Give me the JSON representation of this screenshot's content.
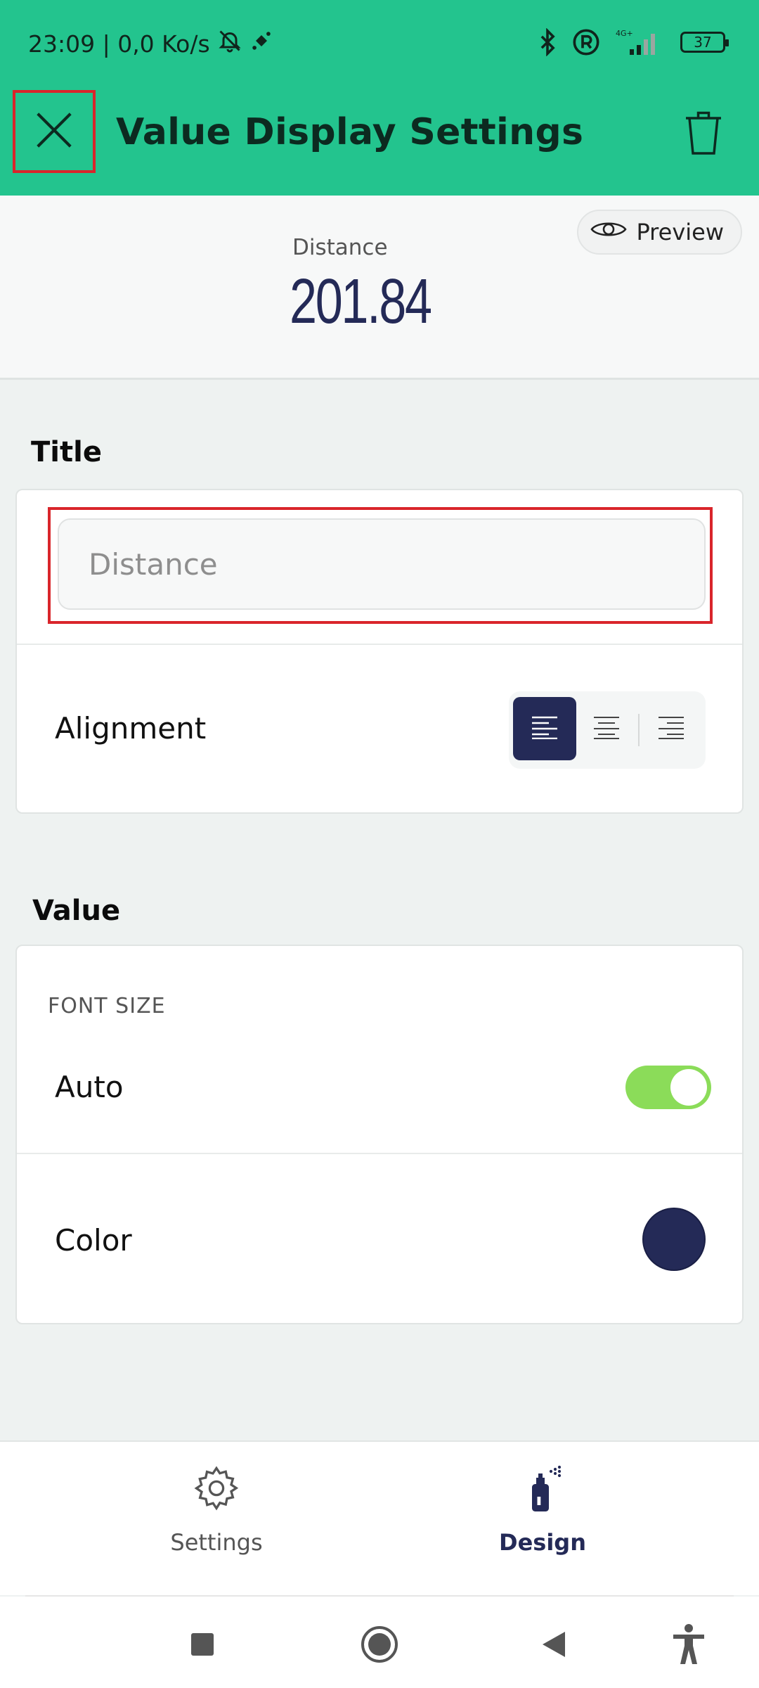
{
  "status_bar": {
    "time_info": "23:09 | 0,0 Ko/s",
    "network_label": "4G+",
    "battery": "37"
  },
  "app_bar": {
    "title": "Value Display Settings",
    "close_icon": "close-icon",
    "delete_icon": "trash-icon"
  },
  "preview": {
    "title": "Distance",
    "value": "201.84",
    "button_label": "Preview",
    "button_icon": "eye-icon"
  },
  "title_section": {
    "header": "Title",
    "input_placeholder": "Distance",
    "alignment_label": "Alignment",
    "alignment_options": [
      "left",
      "center",
      "right"
    ],
    "alignment_selected": "left"
  },
  "value_section": {
    "header": "Value",
    "font_size_caption": "FONT SIZE",
    "auto_label": "Auto",
    "auto_enabled": true,
    "color_label": "Color",
    "color_value": "#242a57"
  },
  "bottom_nav": {
    "items": [
      {
        "label": "Settings",
        "icon": "gear-icon",
        "active": false
      },
      {
        "label": "Design",
        "icon": "spray-can-icon",
        "active": true
      }
    ]
  },
  "colors": {
    "accent": "#23c48e",
    "primary_dark": "#242a57",
    "toggle_on": "#8bdc59",
    "highlight": "#d9252b"
  }
}
